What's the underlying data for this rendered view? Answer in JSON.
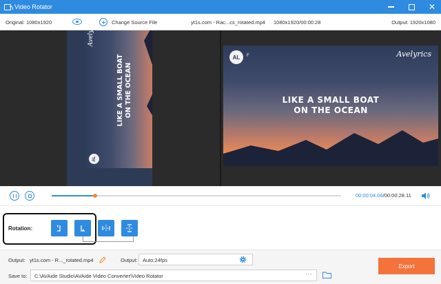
{
  "window": {
    "title": "Video Rotator",
    "icons": [
      "rotate-app-icon",
      "minimize-icon",
      "maximize-icon",
      "close-icon"
    ]
  },
  "infobar": {
    "original": "Original: 1080x1920",
    "change_source": "Change Source File",
    "file_name": "yt1s.com - Rac...cs_rotated.mp4",
    "file_meta": "1080x1920/00:00:28",
    "output": "Output: 1920x1080"
  },
  "preview": {
    "caption_line1": "LIKE A SMALL BOAT",
    "caption_line2": "ON THE OCEAN",
    "logo_text": "AL",
    "logo_suffix": "F",
    "brand": "Avelyrics"
  },
  "player": {
    "current_time": "00:00:04.06",
    "separator": "/",
    "total_time": "00:00:28.11",
    "progress": 0.15
  },
  "rotation": {
    "label": "Rotation:",
    "buttons": [
      {
        "name": "rotate-left",
        "icon": "rotate-left-icon"
      },
      {
        "name": "rotate-right",
        "icon": "rotate-right-icon"
      },
      {
        "name": "flip-horizontal",
        "icon": "flip-horizontal-icon"
      },
      {
        "name": "flip-vertical",
        "icon": "flip-vertical-icon"
      }
    ]
  },
  "output": {
    "label": "Output:",
    "file_name": "yt1s.com - R..._rotated.mp4",
    "format_label": "Output:",
    "format_value": "Auto;24fps"
  },
  "save": {
    "label": "Save to:",
    "path": "C:\\AVAide Studio\\AVAide Video Converter\\Video Rotator",
    "browse": "···"
  },
  "export": {
    "label": "Export"
  },
  "colors": {
    "accent": "#2f8be0",
    "export": "#f4733a",
    "knob": "#f28c28"
  }
}
